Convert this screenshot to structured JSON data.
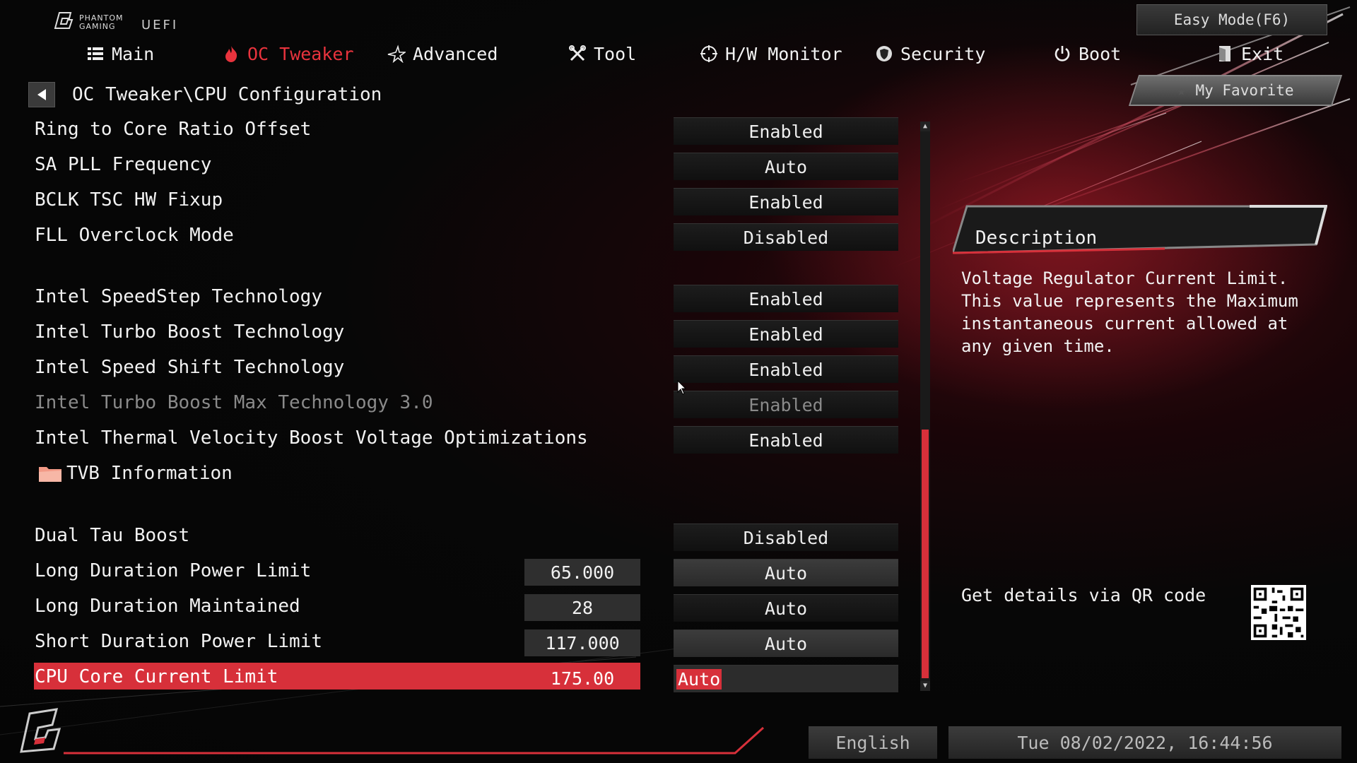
{
  "header": {
    "brand_small": "PHANTOM GAMING",
    "brand_uefi": "UEFI",
    "easy_mode_label": "Easy Mode(F6)"
  },
  "nav": {
    "items": [
      {
        "label": "Main",
        "icon": "list-icon"
      },
      {
        "label": "OC Tweaker",
        "icon": "flame-icon",
        "active": true
      },
      {
        "label": "Advanced",
        "icon": "star-icon"
      },
      {
        "label": "Tool",
        "icon": "tools-icon"
      },
      {
        "label": "H/W Monitor",
        "icon": "crosshair-icon"
      },
      {
        "label": "Security",
        "icon": "shield-icon"
      },
      {
        "label": "Boot",
        "icon": "power-icon"
      },
      {
        "label": "Exit",
        "icon": "exit-door-icon"
      }
    ]
  },
  "breadcrumb": "OC Tweaker\\CPU Configuration",
  "favorite_label": "My Favorite",
  "settings": [
    {
      "label": "Ring to Core Ratio Offset",
      "value": "Enabled"
    },
    {
      "label": "SA PLL Frequency",
      "value": "Auto"
    },
    {
      "label": "BCLK TSC HW Fixup",
      "value": "Enabled"
    },
    {
      "label": "FLL Overclock Mode",
      "value": "Disabled"
    },
    {
      "label": "Intel SpeedStep Technology",
      "value": "Enabled"
    },
    {
      "label": "Intel Turbo Boost Technology",
      "value": "Enabled"
    },
    {
      "label": "Intel Speed Shift Technology",
      "value": "Enabled"
    },
    {
      "label": "Intel Turbo Boost Max Technology 3.0",
      "value": "Enabled",
      "disabled": true
    },
    {
      "label": "Intel Thermal Velocity Boost Voltage Optimizations",
      "value": "Enabled"
    },
    {
      "label": "Dual Tau Boost",
      "value": "Disabled"
    },
    {
      "label": "Long Duration Power Limit",
      "number": "65.000",
      "value": "Auto"
    },
    {
      "label": "Long Duration Maintained",
      "number": "28",
      "value": "Auto"
    },
    {
      "label": "Short Duration Power Limit",
      "number": "117.000",
      "value": "Auto"
    },
    {
      "label": "CPU Core Current Limit",
      "number": "175.00",
      "value": "Auto",
      "selected": true
    }
  ],
  "folder": {
    "label": "TVB Information",
    "icon": "folder-icon"
  },
  "description": {
    "title": "Description",
    "body": "Voltage Regulator Current Limit. This value represents the Maximum instantaneous current allowed at any given time."
  },
  "qr_label": "Get details via QR code",
  "footer": {
    "language": "English",
    "datetime": "Tue 08/02/2022, 16:44:56"
  },
  "colors": {
    "accent": "#d7303a",
    "background": "#050505",
    "text": "#f2f2f2"
  }
}
